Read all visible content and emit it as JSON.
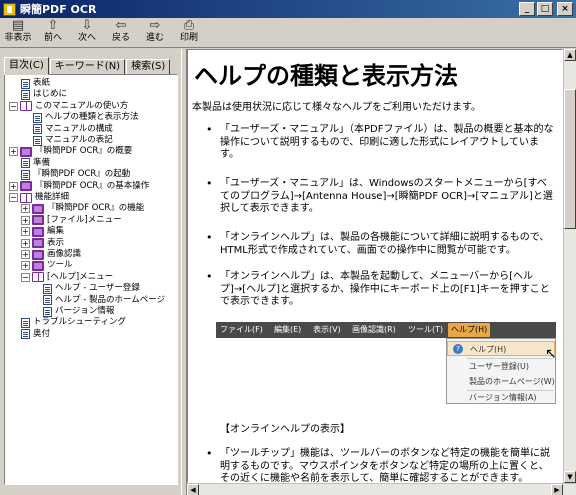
{
  "window": {
    "title": "瞬簡PDF OCR"
  },
  "toolbar": {
    "buttons": [
      {
        "label": "非表示",
        "icon": "hide-icon"
      },
      {
        "label": "前へ",
        "icon": "up-arrow-icon"
      },
      {
        "label": "次へ",
        "icon": "down-arrow-icon"
      },
      {
        "label": "戻る",
        "icon": "back-arrow-icon"
      },
      {
        "label": "進む",
        "icon": "forward-arrow-icon"
      },
      {
        "label": "印刷",
        "icon": "printer-icon"
      }
    ]
  },
  "tabs": [
    {
      "label": "目次(C)"
    },
    {
      "label": "キーワード(N)"
    },
    {
      "label": "検索(S)"
    }
  ],
  "tree": [
    {
      "label": "表紙",
      "level": 1,
      "type": "page"
    },
    {
      "label": "はじめに",
      "level": 1,
      "type": "page"
    },
    {
      "label": "このマニュアルの使い方",
      "level": 0,
      "type": "book-open",
      "exp": "−"
    },
    {
      "label": "ヘルプの種類と表示方法",
      "level": 2,
      "type": "page"
    },
    {
      "label": "マニュアルの構成",
      "level": 2,
      "type": "page"
    },
    {
      "label": "マニュアルの表記",
      "level": 2,
      "type": "page"
    },
    {
      "label": "『瞬簡PDF OCR』の概要",
      "level": 0,
      "type": "book",
      "exp": "+"
    },
    {
      "label": "準備",
      "level": 1,
      "type": "page"
    },
    {
      "label": "『瞬簡PDF OCR』の起動",
      "level": 1,
      "type": "page"
    },
    {
      "label": "『瞬簡PDF OCR』の基本操作",
      "level": 0,
      "type": "book",
      "exp": "+"
    },
    {
      "label": "機能詳細",
      "level": 0,
      "type": "book-open",
      "exp": "−"
    },
    {
      "label": "『瞬簡PDF OCR』の機能",
      "level": 1,
      "type": "book",
      "exp": "+"
    },
    {
      "label": "[ファイル]メニュー",
      "level": 1,
      "type": "book",
      "exp": "+"
    },
    {
      "label": "編集",
      "level": 1,
      "type": "book",
      "exp": "+"
    },
    {
      "label": "表示",
      "level": 1,
      "type": "book",
      "exp": "+"
    },
    {
      "label": "画像認識",
      "level": 1,
      "type": "book",
      "exp": "+"
    },
    {
      "label": "ツール",
      "level": 1,
      "type": "book",
      "exp": "+"
    },
    {
      "label": "[ヘルプ]メニュー",
      "level": 1,
      "type": "book-open",
      "exp": "−"
    },
    {
      "label": "ヘルプ - ユーザー登録",
      "level": 3,
      "type": "page"
    },
    {
      "label": "ヘルプ - 製品のホームページ",
      "level": 3,
      "type": "page"
    },
    {
      "label": "バージョン情報",
      "level": 3,
      "type": "page"
    },
    {
      "label": "トラブルシューティング",
      "level": 1,
      "type": "page"
    },
    {
      "label": "奥付",
      "level": 1,
      "type": "page"
    }
  ],
  "content": {
    "title": "ヘルプの種類と表示方法",
    "intro": "本製品は使用状況に応じて様々なヘルプをご利用いただけます。",
    "bullets": [
      "「ユーザーズ・マニュアル」（本PDFファイル）は、製品の概要と基本的な操作について説明するもので、印刷に適した形式にレイアウトしています。",
      "「ユーザーズ・マニュアル」は、Windowsのスタートメニューから[すべてのプログラム]→[Antenna House]→[瞬簡PDF OCR]→[マニュアル]と選択して表示できます。",
      "「オンラインヘルプ」は、製品の各機能について詳細に説明するもので、HTML形式で作成されていて、画面での操作中に閲覧が可能です。",
      "「オンラインヘルプ」は、本製品を起動して、メニューバーから[ヘルプ]→[ヘルプ]と選択するか、操作中にキーボード上の[F1]キーを押すことで表示できます。"
    ],
    "menubar": [
      "ファイル(F)",
      "編集(E)",
      "表示(V)",
      "画像認識(R)",
      "ツール(T)",
      "ヘルプ(H)"
    ],
    "dropdown": [
      "ヘルプ(H)",
      "ユーザー登録(U)",
      "製品のホームページ(W)",
      "バージョン情報(A)"
    ],
    "section2": "【オンラインヘルプの表示】",
    "bullet5": "「ツールチップ」機能は、ツールバーのボタンなど特定の機能を簡単に説明するものです。マウスポインタをボタンなど特定の場所の上に置くと、その近くに機能や名前を表示して、簡単に確認することができます。"
  }
}
